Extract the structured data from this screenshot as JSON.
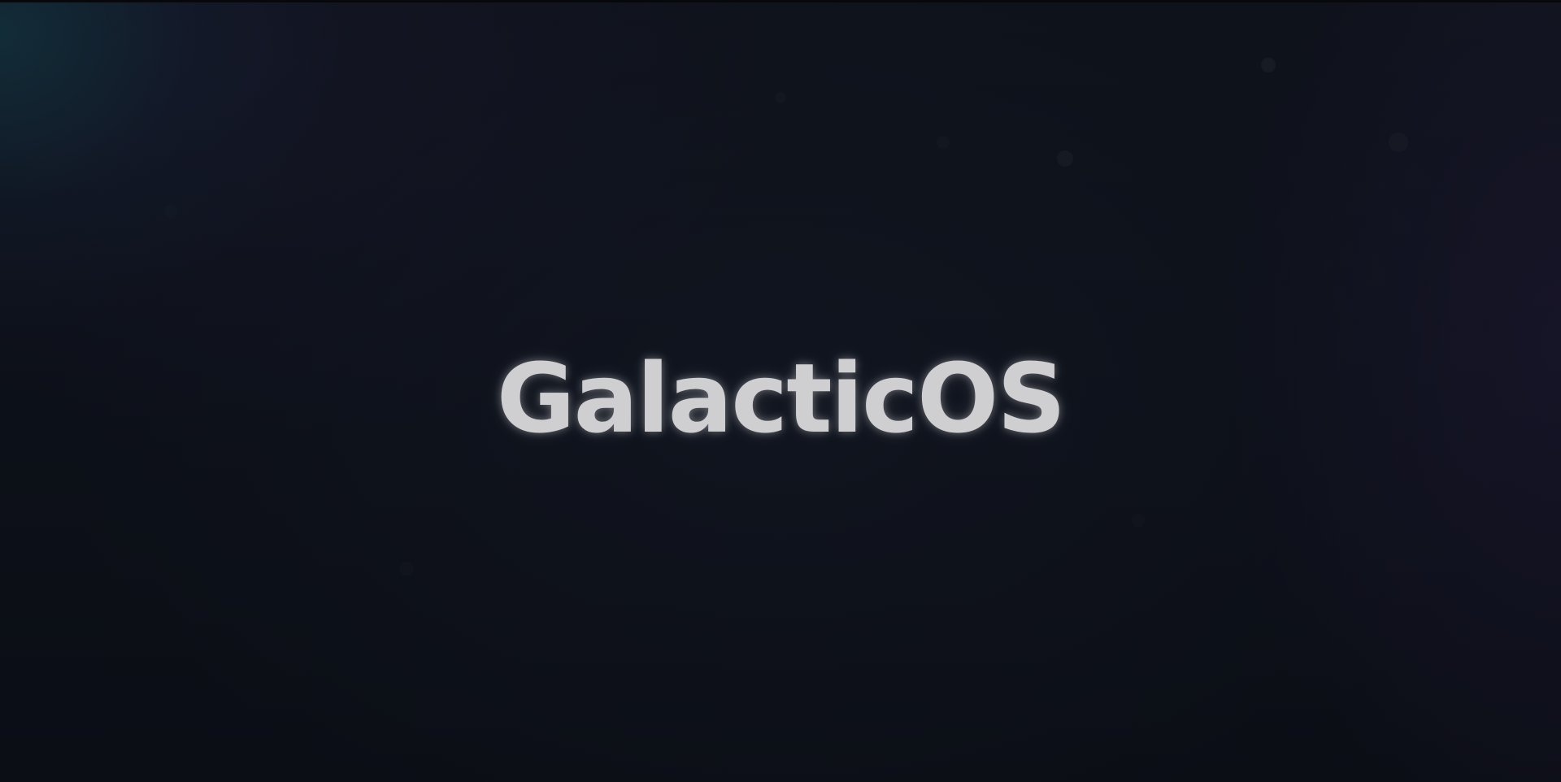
{
  "boot_screen": {
    "title": "GalacticOS"
  },
  "colors": {
    "background": "#0c0f16",
    "title_text": "#cfcfd2",
    "glow_teal": "#145a64",
    "glow_violet": "#2d1e4b"
  }
}
